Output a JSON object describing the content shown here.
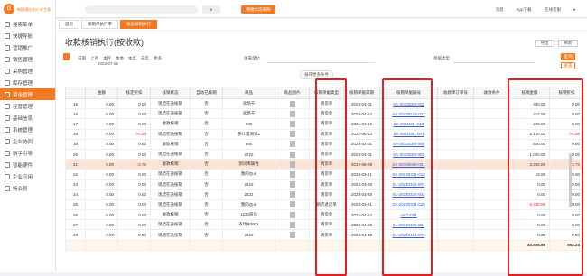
{
  "app": {
    "logo_text": "畅捷通好会计 好生意",
    "logo_mark": "G"
  },
  "sidebar": {
    "items": [
      {
        "label": "搜索菜单",
        "active": false
      },
      {
        "label": "快捷导航",
        "active": false
      },
      {
        "label": "营销推广",
        "active": false
      },
      {
        "label": "销售管理",
        "active": false
      },
      {
        "label": "采购管理",
        "active": false
      },
      {
        "label": "库存管理",
        "active": false
      },
      {
        "label": "资金管理",
        "active": true
      },
      {
        "label": "经营管理",
        "active": false
      },
      {
        "label": "基础信息",
        "active": false
      },
      {
        "label": "系统管理",
        "active": false
      },
      {
        "label": "企业协同",
        "active": false
      },
      {
        "label": "新手引导",
        "active": false
      },
      {
        "label": "智能硬件",
        "active": false
      },
      {
        "label": "企业应用",
        "active": false
      },
      {
        "label": "畅会员",
        "active": false
      }
    ]
  },
  "topbar": {
    "promo": "畅捷优选采购",
    "links": [
      "消息",
      "App下载",
      "在线客服"
    ]
  },
  "tabs": [
    {
      "label": "首页",
      "active": false
    },
    {
      "label": "核销单执行率",
      "active": false
    },
    {
      "label": "收款核销执行",
      "active": true
    }
  ],
  "page": {
    "title": "收款核销执行(按收款)",
    "actions": [
      "导出",
      "刷新"
    ],
    "filter": {
      "date_label": "日期",
      "date_options": [
        "上月",
        "本月",
        "本季",
        "本年",
        "去年",
        "更多"
      ],
      "date_value": "2023-07-26",
      "customer_label": "往来单位",
      "type_label": "单据类型",
      "query_button": "查询",
      "reset_button": "重置",
      "expand_label": "展开更多条件"
    }
  },
  "table": {
    "headers": [
      "",
      "金额",
      "核定折扣",
      "核销状态",
      "自动已核销",
      "商品",
      "商品图片",
      "核销单据类型",
      "核销单据日期",
      "核销单据编号",
      "收款单订单号",
      "收款条件",
      "核销金额",
      "核销折扣"
    ],
    "rows": [
      {
        "no": "15",
        "amount": "0.00",
        "disc": "0.00",
        "status": "现结在途核销",
        "auto": "否",
        "product": "农场干",
        "img": true,
        "type": "销货单",
        "date": "2023-03-01",
        "code": "SA-2023030l-001",
        "order": "",
        "cond": "",
        "wamt": "300.00",
        "wdisc": "0.00",
        "hl": false
      },
      {
        "no": "16",
        "amount": "0.00",
        "disc": "0.00",
        "status": "现结在途核销",
        "auto": "否",
        "product": "农场干",
        "img": true,
        "type": "销货单",
        "date": "2023-04-14",
        "code": "SA-20230414-017",
        "order": "",
        "cond": "",
        "wamt": "312.00",
        "wdisc": "0.00",
        "hl": false
      },
      {
        "no": "17",
        "amount": "0.00",
        "disc": "0.00",
        "status": "收款核销",
        "auto": "否",
        "product": "990",
        "img": true,
        "type": "销货单",
        "date": "2021-03-19",
        "code": "SA-2021031-019",
        "order": "",
        "cond": "",
        "wamt": "200.00",
        "wdisc": "0.00",
        "hl": false
      },
      {
        "no": "18",
        "amount": "0.00",
        "disc": "-70.00",
        "status": "现结在途核销",
        "auto": "否",
        "product": "多计量测试2",
        "img": true,
        "type": "销货单",
        "date": "2021-08-13",
        "code": "SA-2021081-001",
        "order": "",
        "cond": "",
        "wamt": "2,100.00",
        "wdisc": "-70.00",
        "hl": false
      },
      {
        "no": "19",
        "amount": "0.00",
        "disc": "0.00",
        "status": "收款核销",
        "auto": "否",
        "product": "990",
        "img": true,
        "type": "销货单",
        "date": "2023-03-01",
        "code": "SA-2023030l-005",
        "order": "",
        "cond": "",
        "wamt": "600.00",
        "wdisc": "0.00",
        "hl": false
      },
      {
        "no": "20",
        "amount": "0.00",
        "disc": "0.00",
        "status": "现结在途核销",
        "auto": "否",
        "product": "2222",
        "img": true,
        "type": "销货单",
        "date": "2023-03-01",
        "code": "SA-2023030l-002",
        "order": "",
        "cond": "",
        "wamt": "1,000.00",
        "wdisc": "0.00",
        "hl": false
      },
      {
        "no": "21",
        "amount": "0.00",
        "disc": "-2.75",
        "status": "收款核销",
        "auto": "否",
        "product": "测试库属性",
        "img": true,
        "type": "销货单",
        "date": "2019-08-08",
        "code": "SA-20190808-001",
        "order": "",
        "cond": "",
        "wamt": "3,350.00",
        "wdisc": "-2.75",
        "hl": true
      },
      {
        "no": "22",
        "amount": "0.00",
        "disc": "0.00",
        "status": "现结在途核销",
        "auto": "否",
        "product": "我的Qun",
        "img": true,
        "type": "销货单",
        "date": "2023-03-21",
        "code": "SA-20230321-012",
        "order": "",
        "cond": "",
        "wamt": "10.00",
        "wdisc": "0.00",
        "hl": false
      },
      {
        "no": "23",
        "amount": "0.00",
        "disc": "0.00",
        "status": "现结在途核销",
        "auto": "否",
        "product": "2222",
        "img": true,
        "type": "销货单",
        "date": "2023-03-28",
        "code": "SL-20230328-001",
        "order": "",
        "cond": "",
        "wamt": "0.00",
        "wdisc": "0.00",
        "hl": false
      },
      {
        "no": "24",
        "amount": "0.00",
        "disc": "0.00",
        "status": "现结在途核销",
        "auto": "否",
        "product": "2222",
        "img": true,
        "type": "销货单",
        "date": "2023-03-28",
        "code": "SL-20230328-002",
        "order": "",
        "cond": "",
        "wamt": "0.00",
        "wdisc": "0.00",
        "hl": false
      },
      {
        "no": "25",
        "amount": "0.00",
        "disc": "0.00",
        "status": "现结在途核销",
        "auto": "否",
        "product": "我的Qun",
        "img": true,
        "type": "销货退货单",
        "date": "2023-03-21",
        "code": "SA-20230321-026",
        "order": "",
        "cond": "",
        "wamt": "-2,430.00",
        "wdisc": "0.00",
        "hl": false
      },
      {
        "no": "26",
        "amount": "0.00",
        "disc": "0.00",
        "status": "收款核销",
        "auto": "否",
        "product": "1230商品",
        "img": true,
        "type": "销货单",
        "date": "2022-04-14",
        "code": "ABC-001",
        "order": "",
        "cond": "",
        "wamt": "0.00",
        "wdisc": "0.00",
        "hl": false
      },
      {
        "no": "27",
        "amount": "0.00",
        "disc": "0.00",
        "status": "现结在途核销",
        "auto": "否",
        "product": "农场B0001",
        "img": true,
        "type": "销货单",
        "date": "2023-04-08",
        "code": "SL-20230408-001",
        "order": "",
        "cond": "",
        "wamt": "0.00",
        "wdisc": "0.00",
        "hl": false
      },
      {
        "no": "28",
        "amount": "0.00",
        "disc": "0.00",
        "status": "现结在途核销",
        "auto": "否",
        "product": "2222",
        "img": true,
        "type": "销货单",
        "date": "2023-04-18",
        "code": "SL-20230418-001",
        "order": "",
        "cond": "",
        "wamt": "0.00",
        "wdisc": "0.00",
        "hl": false
      }
    ],
    "total_amount": "40,556.66",
    "total_disc": "952.24"
  }
}
